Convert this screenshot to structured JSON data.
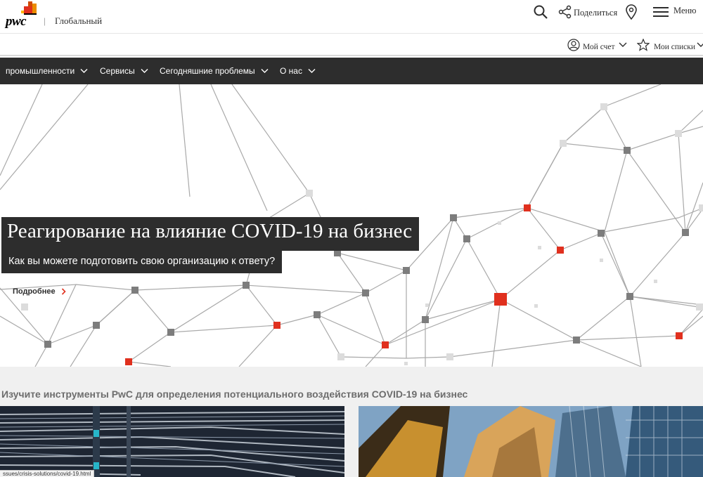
{
  "header": {
    "brand": "pwc",
    "separator": "|",
    "territory": "Глобальный",
    "share_label": "Поделиться",
    "menu_label": "Меню"
  },
  "subbar": {
    "account_label": "Мой счет",
    "lists_label": "Мои списки"
  },
  "nav": {
    "items": [
      {
        "label": "промышленности"
      },
      {
        "label": "Сервисы"
      },
      {
        "label": "Сегодняшние проблемы"
      },
      {
        "label": "О нас"
      }
    ]
  },
  "hero": {
    "title": "Реагирование на влияние COVID-19 на бизнес",
    "subtitle": "Как вы можете подготовить свою организацию к ответу?",
    "cta": "Подробнее"
  },
  "section": {
    "heading": "Изучите инструменты PwC для определения потенциального воздействия COVID-19 на бизнес"
  },
  "status_bar": {
    "url": "ssues/crisis-solutions/covid-19.html"
  },
  "colors": {
    "nav_bg": "#2d2d2d",
    "accent_red": "#e0301e",
    "node_gray": "#7d7d7d",
    "node_light": "#dedede"
  }
}
